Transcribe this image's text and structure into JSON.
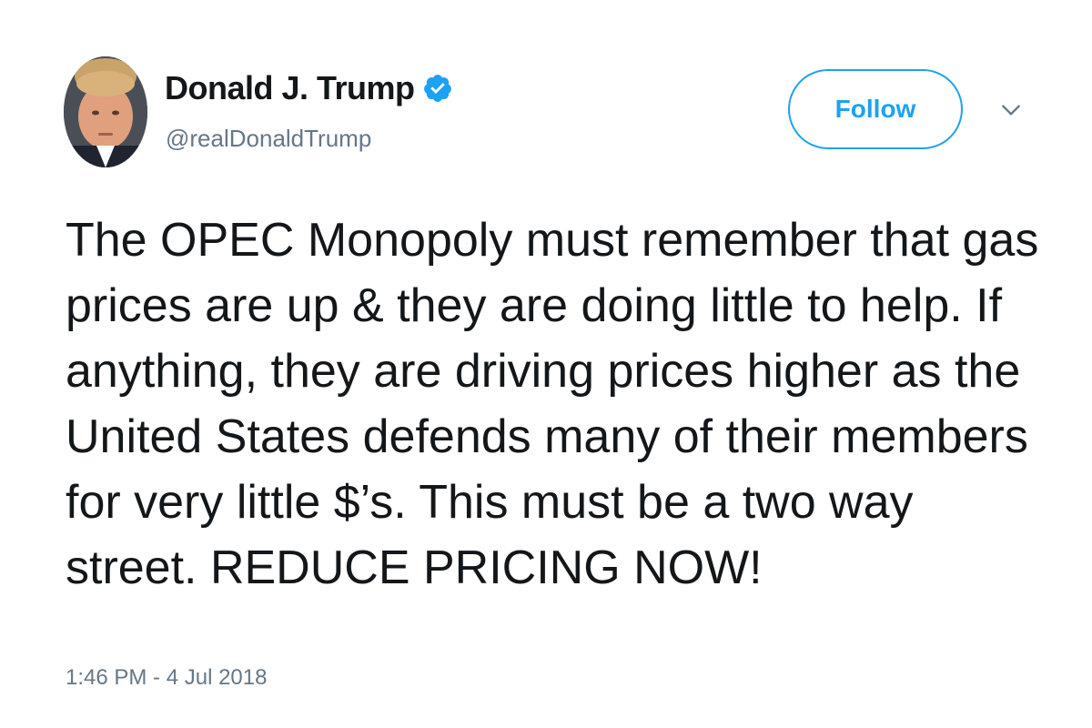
{
  "author": {
    "display_name": "Donald J. Trump",
    "handle": "@realDonaldTrump",
    "verified": true,
    "avatar_icon": "profile-photo-avatar"
  },
  "actions": {
    "follow_label": "Follow",
    "more_icon": "chevron-down-icon"
  },
  "tweet": {
    "lines": [
      "The OPEC Monopoly must remember that gas",
      "prices are up & they are doing little to help. If",
      "anything, they are driving prices higher as the",
      "United States defends many of their members",
      "for very little $’s. This must be a two way",
      "street. REDUCE PRICING NOW!"
    ],
    "timestamp": "1:46 PM - 4 Jul 2018"
  },
  "colors": {
    "accent": "#1da1f2",
    "text": "#14171a",
    "secondary_text": "#657786"
  }
}
